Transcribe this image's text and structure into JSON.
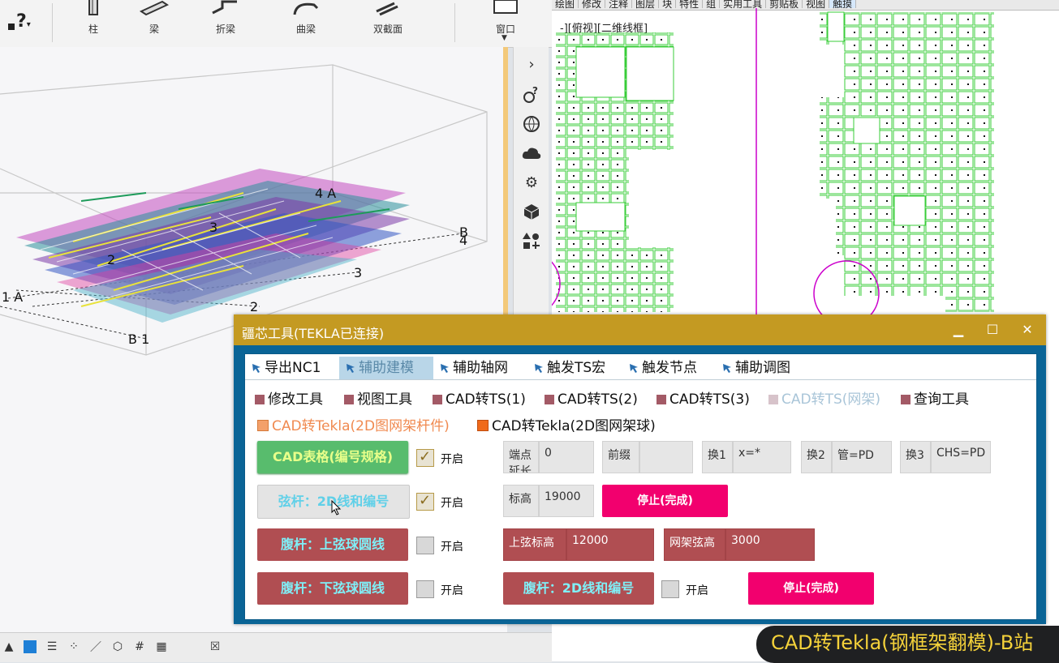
{
  "ribbon": {
    "help_symbol": "?",
    "items": [
      {
        "label": "柱",
        "icon": "column-icon"
      },
      {
        "label": "梁",
        "icon": "beam-icon"
      },
      {
        "label": "折梁",
        "icon": "polybeam-icon"
      },
      {
        "label": "曲梁",
        "icon": "curved-beam-icon"
      },
      {
        "label": "双截面",
        "icon": "twin-profile-icon"
      },
      {
        "label": "窗口",
        "icon": "window-icon"
      }
    ]
  },
  "view3d": {
    "grid_labels": [
      "4 A",
      "3",
      "B",
      "4",
      "2",
      "3",
      "1 A",
      "2",
      "B 1"
    ]
  },
  "sidebar": {
    "icons": [
      "chevron-right-icon",
      "help-settings-icon",
      "globe-icon",
      "cloud-icon",
      "gear-icon",
      "cube-icon",
      "shapes-icon"
    ]
  },
  "cad": {
    "menu": [
      "绘图",
      "修改",
      "注释",
      "图层",
      "块",
      "特性",
      "组",
      "实用工具",
      "剪贴板",
      "视图",
      "触摸"
    ],
    "active_menu": "触摸",
    "view_label": "-][俯视][二维线框]"
  },
  "dialog": {
    "title": "疆芯工具(TEKLA已连接)",
    "window_buttons": [
      "minimize-icon",
      "maximize-icon",
      "close-icon"
    ],
    "tabs": [
      {
        "label": "导出NC1",
        "active": false
      },
      {
        "label": "辅助建模",
        "active": true
      },
      {
        "label": "辅助轴网",
        "active": false
      },
      {
        "label": "触发TS宏",
        "active": false
      },
      {
        "label": "触发节点",
        "active": false
      },
      {
        "label": "辅助调图",
        "active": false
      }
    ],
    "options_row1": [
      {
        "label": "修改工具",
        "dim": false
      },
      {
        "label": "视图工具",
        "dim": false
      },
      {
        "label": "CAD转TS(1)",
        "dim": false
      },
      {
        "label": "CAD转TS(2)",
        "dim": false
      },
      {
        "label": "CAD转TS(3)",
        "dim": false
      },
      {
        "label": "CAD转TS(网架)",
        "dim": true
      },
      {
        "label": "查询工具",
        "dim": false
      }
    ],
    "options_row2": [
      {
        "label": "CAD转Tekla(2D图网架杆件)",
        "dim": true
      },
      {
        "label": "CAD转Tekla(2D图网架球)",
        "dim": false
      }
    ],
    "buttons": {
      "cad_table": "CAD表格(编号规格)",
      "chord_2d": "弦杆：2D线和编号",
      "web_upper": "腹杆：上弦球圆线",
      "web_lower": "腹杆：下弦球圆线",
      "web_2d": "腹杆：2D线和编号",
      "stop1": "停止(完成)",
      "stop2": "停止(完成)"
    },
    "toggles": [
      {
        "label": "开启",
        "checked": true
      },
      {
        "label": "开启",
        "checked": true
      },
      {
        "label": "开启",
        "checked": false
      },
      {
        "label": "开启",
        "checked": false
      },
      {
        "label": "开启",
        "checked": false
      }
    ],
    "fields": {
      "endpoint_label": "端点延长",
      "endpoint_value": "0",
      "prefix_label": "前缀",
      "prefix_value": "",
      "rep1_label": "换1",
      "rep1_value": "x=*",
      "rep2_label": "换2",
      "rep2_value": "管=PD",
      "rep3_label": "换3",
      "rep3_value": "CHS=PD",
      "elev_label": "标高",
      "elev_value": "19000",
      "upper_elev_label": "上弦标高",
      "upper_elev_value": "12000",
      "truss_label": "网架弦高",
      "truss_value": "3000"
    }
  },
  "subtitle": "CAD转Tekla(钢框架翻模)-B站",
  "colors": {
    "dialog_title": "#c49a22",
    "dialog_frame": "#0a6496",
    "accent_pink": "#f2006e",
    "button_red": "#b04e52",
    "button_green": "#58bc6d",
    "cad_lines": "#33cc33",
    "cad_circle": "#cc00cc"
  }
}
